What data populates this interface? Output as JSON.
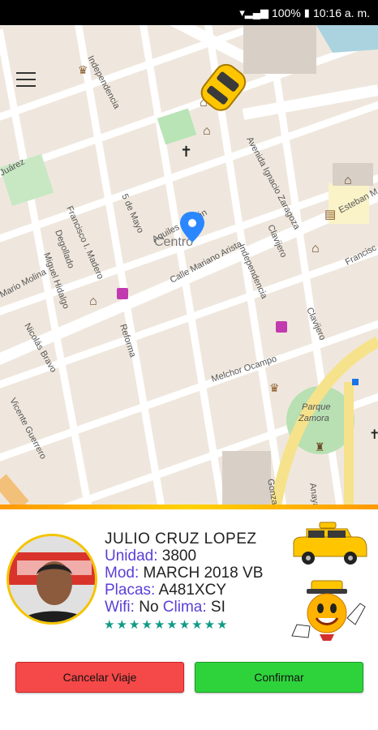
{
  "status_bar": {
    "signal_icon": "wifi-signal-icon",
    "battery": "100%",
    "time": "10:16 a. m."
  },
  "map": {
    "center_label": "Centro",
    "streets": [
      "Independencia",
      "Aquiles Serdán",
      "5 de Mayo",
      "Francisco I. Madero",
      "Degollado",
      "Miguel Hidalgo",
      "Reforma",
      "Calle Mariano Arista",
      "Avenida Ignacio Zaragoza",
      "Clavijero",
      "Independencia",
      "Clavijero",
      "Melchor Ocampo",
      "Nicolás Bravo",
      "Vicente Guerrero",
      "Mario Molina",
      "Juárez",
      "Esteban M",
      "Francisc",
      "Parque Zamora",
      "Gonzalez Pagés",
      "Anaya"
    ]
  },
  "driver": {
    "name": "JULIO CRUZ LOPEZ",
    "unit_label": "Unidad:",
    "unit_value": "3800",
    "model_label": "Mod:",
    "model_value": "MARCH 2018 VB",
    "plates_label": "Placas:",
    "plates_value": "A481XCY",
    "wifi_label": "Wifi:",
    "wifi_value": "No",
    "climate_label": "Clima:",
    "climate_value": "SI",
    "rating_stars": 10
  },
  "actions": {
    "cancel_label": "Cancelar Viaje",
    "confirm_label": "Confirmar"
  },
  "colors": {
    "accent_label": "#5b3fd6",
    "star": "#0f9a86",
    "cancel": "#f54848",
    "confirm": "#2ed33c",
    "divider": "#ffb000"
  }
}
